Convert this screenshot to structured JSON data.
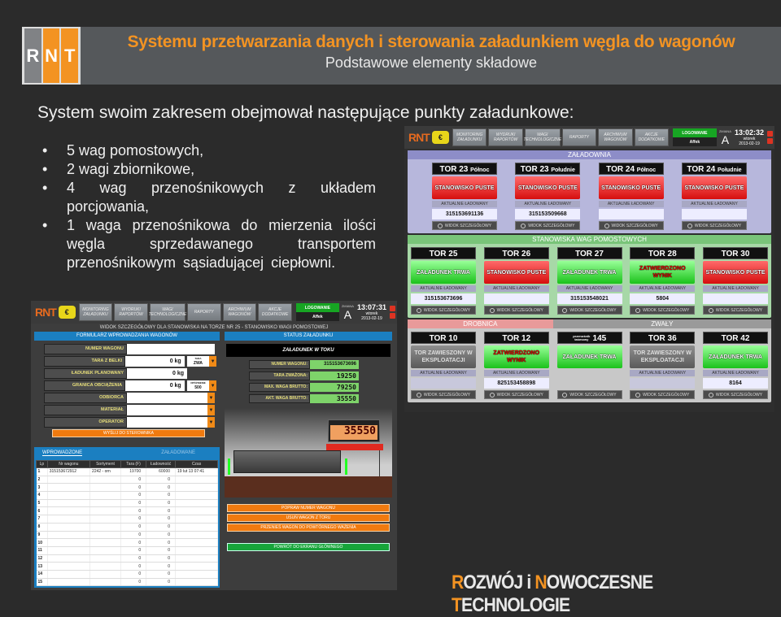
{
  "header": {
    "logo_letters": [
      "R",
      "N",
      "T"
    ],
    "title": "Systemu przetwarzania danych i sterowania załadunkiem węgla do wagonów",
    "subtitle": "Podstawowe elementy składowe"
  },
  "intro": "System swoim zakresem obejmował następujące punkty załadunkowe:",
  "bullets": [
    "5 wag pomostowych,",
    "2 wagi zbiornikowe,",
    "4 wag przenośnikowych z układem porcjowania,",
    "1 waga przenośnikowa do mierzenia ilości węgla sprzedawanego transportem przenośnikowym sąsiadującej ciepłowni."
  ],
  "nav": {
    "logo": "RNT",
    "items": [
      "MONITORING ZAŁADUNKU",
      "WYDRUKI RAPORTÓW",
      "WAGI TECHNOLOGICZNE",
      "RAPORTY",
      "ARCHIWUM WAGONÓW",
      "AKCJE DODATKOWE"
    ],
    "login_label": "LOGOWANIE",
    "user": "Affek",
    "shift_label": "ZMIANA",
    "shift": "A"
  },
  "right_screen": {
    "time": "13:02:32",
    "day": "wtorek",
    "date": "2013-02-19",
    "sections": {
      "zaladownia": "ZAŁADOWNIA",
      "pomostowe": "STANOWISKA WAG POMOSTOWYCH",
      "drobnica": "DROBNICA",
      "zwaly": "ZWAŁY"
    },
    "current_label": "AKTUALNIE ŁADOWANY",
    "detail_label": "WIDOK SZCZEGÓŁOWY",
    "zaladownia_cards": [
      {
        "title": "TOR 23",
        "sub": "Północ",
        "state": "STANOWISKO PUSTE",
        "color": "red",
        "value": "315153691136"
      },
      {
        "title": "TOR 23",
        "sub": "Południe",
        "state": "STANOWISKO PUSTE",
        "color": "red",
        "value": "315153509668"
      },
      {
        "title": "TOR 24",
        "sub": "Północ",
        "state": "STANOWISKO PUSTE",
        "color": "red",
        "value": ""
      },
      {
        "title": "TOR 24",
        "sub": "Południe",
        "state": "STANOWISKO PUSTE",
        "color": "red",
        "value": ""
      }
    ],
    "pomostowe_cards": [
      {
        "title": "TOR 25",
        "state": "ZAŁADUNEK TRWA",
        "color": "green",
        "value": "315153673696"
      },
      {
        "title": "TOR 26",
        "state": "STANOWISKO PUSTE",
        "color": "red",
        "value": ""
      },
      {
        "title": "TOR 27",
        "state": "ZAŁADUNEK TRWA",
        "color": "green",
        "value": "315153548021"
      },
      {
        "title": "TOR 28",
        "state": "ZATWIERDZONO WYNIK",
        "color": "greenr",
        "value": "5804"
      },
      {
        "title": "TOR 30",
        "state": "STANOWISKO PUSTE",
        "color": "red",
        "value": ""
      }
    ],
    "bottom_cards": [
      {
        "title": "TOR 10",
        "state": "TOR ZAWIESZONY W EKSPLOATACJI",
        "color": "gray",
        "value": ""
      },
      {
        "title": "TOR 12",
        "state": "ZATWIERDZONO WYNIK",
        "color": "greenr",
        "value": "825153458898"
      },
      {
        "title": "145",
        "pre": "przenośnik taśmowy",
        "state": "ZAŁADUNEK TRWA",
        "color": "green",
        "value": null
      },
      {
        "title": "TOR 36",
        "state": "TOR ZAWIESZONY W EKSPLOATACJI",
        "color": "gray",
        "value": ""
      },
      {
        "title": "TOR 42",
        "state": "ZAŁADUNEK TRWA",
        "color": "green",
        "value": "8164"
      }
    ]
  },
  "left_screen": {
    "time": "13:07:31",
    "day": "wtorek",
    "date": "2013-02-19",
    "heading": "WIDOK SZCZEGÓŁOWY DLA STANOWISKA NA TORZE NR 25 - STANOWISKO WAGI POMOSTOWEJ",
    "form_title": "FORMULARZ WPROWADZANIA WAGONÓW",
    "status_title": "STATUS ZAŁADUNKU",
    "form": {
      "numer_wagonu": {
        "label": "NUMER WAGONU",
        "value": ""
      },
      "tara": {
        "label": "TARA Z BELKI",
        "value": "0",
        "unit": "kg",
        "sel_label": "TARA",
        "sel_value": "ZWA"
      },
      "ladunek": {
        "label": "ŁADUNEK PLANOWANY",
        "value": "0",
        "unit": "kg"
      },
      "granica": {
        "label": "GRANICA OBCIĄŻENIA",
        "value": "0",
        "unit": "kg",
        "sel_label": "OPÓŹNIENIE",
        "sel_value": "500"
      },
      "odbiorca": {
        "label": "ODBIORCA",
        "value": ""
      },
      "material": {
        "label": "MATERIAŁ",
        "value": ""
      },
      "operator": {
        "label": "OPERATOR",
        "value": ""
      },
      "send": "WYŚLIJ DO STEROWNIKA"
    },
    "status": {
      "banner": "ZAŁADUNEK W TOKU",
      "rows": [
        {
          "label": "NUMER WAGONU:",
          "value": "315153673696"
        },
        {
          "label": "TARA ZWAŻONA:",
          "value": "19250"
        },
        {
          "label": "MAX. WAGA BRUTTO:",
          "value": "79250"
        },
        {
          "label": "AKT. WAGA BRUTTO:",
          "value": "35550"
        }
      ],
      "display": "35550"
    },
    "tabs": [
      "WPROWADZONE",
      "ZAŁADOWANE"
    ],
    "table": {
      "headers": [
        "Lp",
        "Nr wagonu",
        "Sortyment",
        "Tara (F)",
        "Ładowność",
        "Czas"
      ],
      "rows": [
        [
          "1",
          "315153672912",
          "2242 - orn",
          "19700",
          "60000",
          "19 lut 13 07:41"
        ],
        [
          "2",
          "",
          "",
          "0",
          "0",
          ""
        ],
        [
          "3",
          "",
          "",
          "0",
          "0",
          ""
        ],
        [
          "4",
          "",
          "",
          "0",
          "0",
          ""
        ],
        [
          "5",
          "",
          "",
          "0",
          "0",
          ""
        ],
        [
          "6",
          "",
          "",
          "0",
          "0",
          ""
        ],
        [
          "7",
          "",
          "",
          "0",
          "0",
          ""
        ],
        [
          "8",
          "",
          "",
          "0",
          "0",
          ""
        ],
        [
          "9",
          "",
          "",
          "0",
          "0",
          ""
        ],
        [
          "10",
          "",
          "",
          "0",
          "0",
          ""
        ],
        [
          "11",
          "",
          "",
          "0",
          "0",
          ""
        ],
        [
          "12",
          "",
          "",
          "0",
          "0",
          ""
        ],
        [
          "13",
          "",
          "",
          "0",
          "0",
          ""
        ],
        [
          "14",
          "",
          "",
          "0",
          "0",
          ""
        ],
        [
          "15",
          "",
          "",
          "0",
          "0",
          ""
        ]
      ]
    },
    "actions": [
      "POPRAW NUMER WAGONU",
      "USUŃ WAGON Z TORU",
      "PRZENIEŚ WAGON DO POWTÓRNEGO WAŻENIA"
    ],
    "back": "POWRÓT DO EKRANU GŁÓWNEGO"
  },
  "footer": {
    "parts": [
      {
        "t": "R",
        "accent": true
      },
      {
        "t": "OZWÓJ i ",
        "accent": false
      },
      {
        "t": "N",
        "accent": true
      },
      {
        "t": "OWOCZESNE ",
        "accent": false
      },
      {
        "t": "T",
        "accent": true
      },
      {
        "t": "ECHNOLOGIE",
        "accent": false
      }
    ]
  },
  "colors": {
    "accent": "#f39322",
    "ok": "#1bc21b",
    "alarm": "#d60e0e",
    "info": "#1b7fc1"
  }
}
